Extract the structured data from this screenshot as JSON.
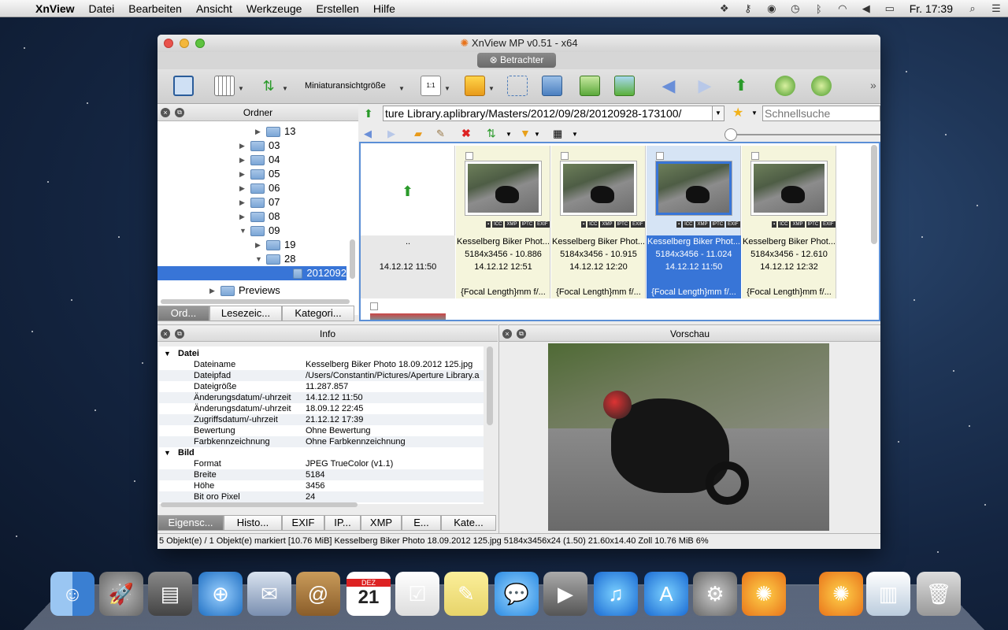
{
  "menubar": {
    "app": "XnView",
    "items": [
      "Datei",
      "Bearbeiten",
      "Ansicht",
      "Werkzeuge",
      "Erstellen",
      "Hilfe"
    ],
    "clock": "Fr. 17:39"
  },
  "window": {
    "title": "XnView MP v0.51 - x64",
    "tab": "Betrachter",
    "toolbar_thumb_size_label": "Miniaturansichtgröße"
  },
  "folder_panel": {
    "title": "Ordner",
    "items": [
      {
        "label": "13",
        "indent": 2,
        "arrow": "▶"
      },
      {
        "label": "03",
        "indent": 1,
        "arrow": "▶"
      },
      {
        "label": "04",
        "indent": 1,
        "arrow": "▶"
      },
      {
        "label": "05",
        "indent": 1,
        "arrow": "▶"
      },
      {
        "label": "06",
        "indent": 1,
        "arrow": "▶"
      },
      {
        "label": "07",
        "indent": 1,
        "arrow": "▶"
      },
      {
        "label": "08",
        "indent": 1,
        "arrow": "▶"
      },
      {
        "label": "09",
        "indent": 1,
        "arrow": "▼"
      },
      {
        "label": "19",
        "indent": 2,
        "arrow": "▶"
      },
      {
        "label": "28",
        "indent": 2,
        "arrow": "▼"
      },
      {
        "label": "2012092",
        "indent": 3,
        "arrow": ""
      },
      {
        "label": "Previews",
        "indent": 0,
        "arrow": "▶"
      }
    ],
    "tabs": [
      "Ord...",
      "Lesezeic...",
      "Kategori..."
    ]
  },
  "address": {
    "path": "ture Library.aplibrary/Masters/2012/09/28/20120928-173100/",
    "search_placeholder": "Schnellsuche"
  },
  "thumbnails": {
    "parent": {
      "label": "..",
      "date": "14.12.12 11:50"
    },
    "items": [
      {
        "name": "Kesselberg Biker Phot...",
        "info": "5184x3456 - 10.886",
        "date": "14.12.12 12:51",
        "focal": "{Focal Length}mm f/...",
        "selected": false
      },
      {
        "name": "Kesselberg Biker Phot...",
        "info": "5184x3456 - 10.915",
        "date": "14.12.12 12:20",
        "focal": "{Focal Length}mm f/...",
        "selected": false
      },
      {
        "name": "Kesselberg Biker Phot...",
        "info": "5184x3456 - 11.024",
        "date": "14.12.12 11:50",
        "focal": "{Focal Length}mm f/...",
        "selected": true
      },
      {
        "name": "Kesselberg Biker Phot...",
        "info": "5184x3456 - 12.610",
        "date": "14.12.12 12:32",
        "focal": "{Focal Length}mm f/...",
        "selected": false
      }
    ],
    "badges": [
      "ICC",
      "XMP",
      "IPTC",
      "EXIF"
    ]
  },
  "info_panel": {
    "title": "Info",
    "sections": [
      {
        "header": "Datei",
        "rows": [
          [
            "Dateiname",
            "Kesselberg Biker Photo 18.09.2012 125.jpg"
          ],
          [
            "Dateipfad",
            "/Users/Constantin/Pictures/Aperture Library.a"
          ],
          [
            "Dateigröße",
            "11.287.857"
          ],
          [
            "Änderungsdatum/-uhrzeit",
            "14.12.12 11:50"
          ],
          [
            "Änderungsdatum/-uhrzeit",
            "18.09.12 22:45"
          ],
          [
            "Zugriffsdatum/-uhrzeit",
            "21.12.12 17:39"
          ],
          [
            "Bewertung",
            "Ohne Bewertung"
          ],
          [
            "Farbkennzeichnung",
            "Ohne Farbkennzeichnung"
          ]
        ]
      },
      {
        "header": "Bild",
        "rows": [
          [
            "Format",
            "JPEG TrueColor (v1.1)"
          ],
          [
            "Breite",
            "5184"
          ],
          [
            "Höhe",
            "3456"
          ],
          [
            "Bit oro Pixel",
            "24"
          ]
        ]
      }
    ],
    "tabs": [
      "Eigensc...",
      "Histo...",
      "EXIF",
      "IP...",
      "XMP",
      "E...",
      "Kate..."
    ]
  },
  "preview_panel": {
    "title": "Vorschau"
  },
  "status": "5 Objekt(e) / 1 Objekt(e) markiert [10.76 MiB]   Kesselberg Biker Photo 18.09.2012 125.jpg   5184x3456x24 (1.50)   21.60x14.40 Zoll   10.76 MiB   6%",
  "dock": {
    "calendar_month": "DEZ",
    "calendar_day": "21"
  },
  "colors": {
    "selection": "#3875d7",
    "cell_bg": "#f5f5dc"
  }
}
